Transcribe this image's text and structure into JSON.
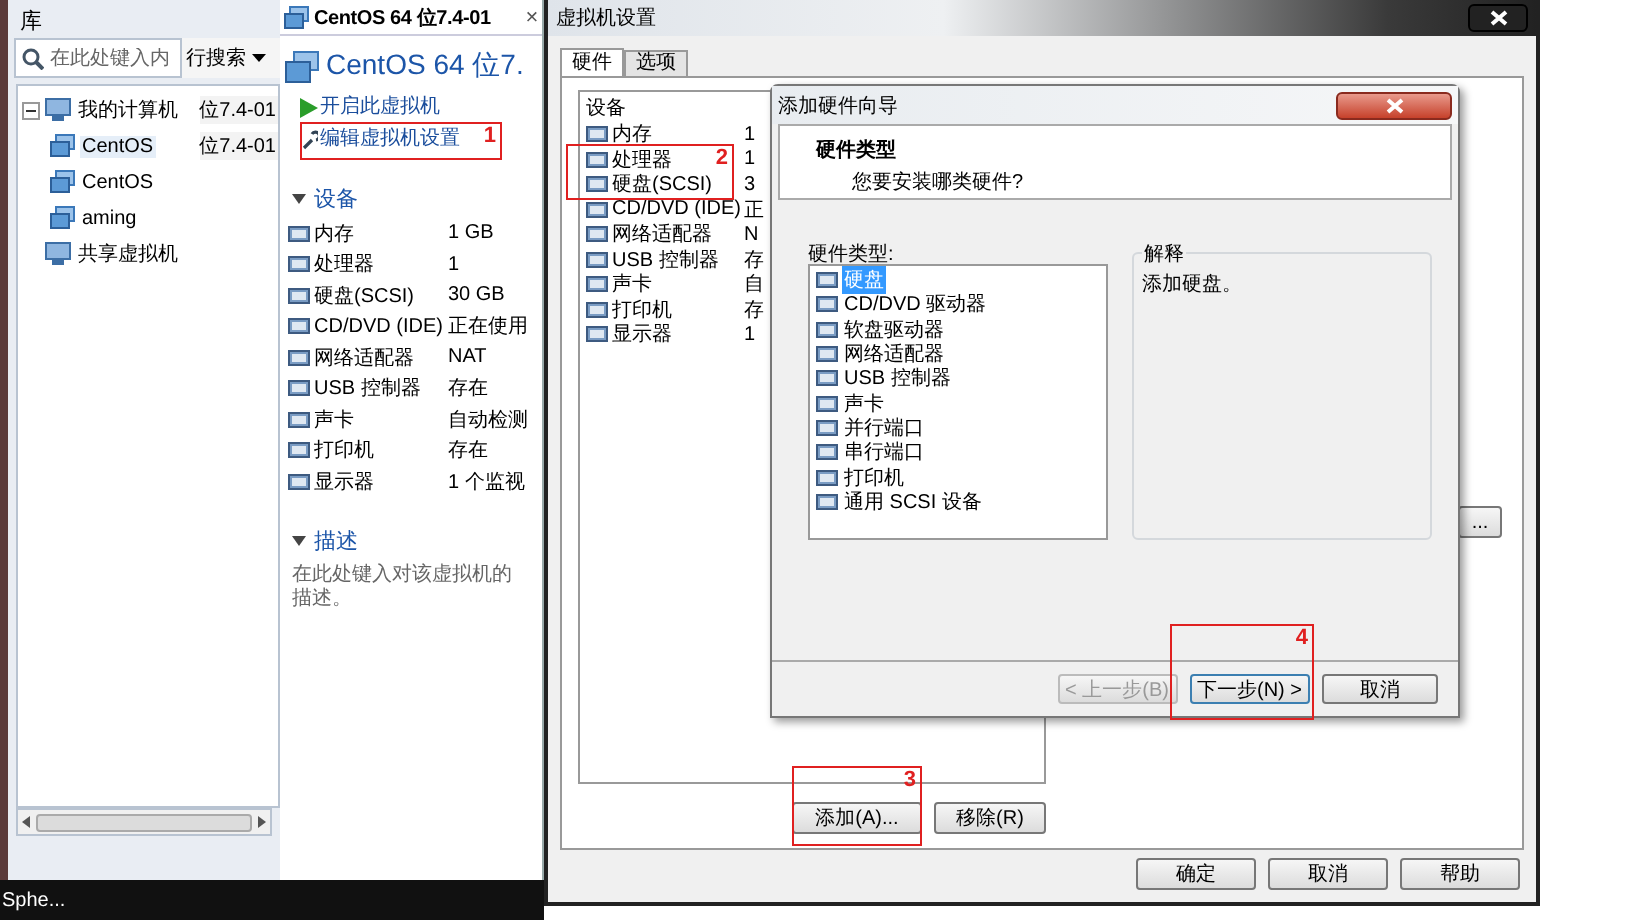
{
  "library": {
    "title": "库",
    "search": {
      "placeholder": "在此处键入内"
    },
    "search_overlap": "行搜索",
    "tree": [
      {
        "label": "我的计算机",
        "trailing": "位7.4-01",
        "expanded": true,
        "children": [
          {
            "label": "CentOS",
            "trailing": "位7.4-01",
            "selected": true
          },
          {
            "label": "CentOS",
            "selected": false
          },
          {
            "label": "aming",
            "selected": false
          }
        ]
      },
      {
        "label": "共享虚拟机"
      }
    ]
  },
  "vm_tab": {
    "tab": {
      "title": "CentOS 64 位7.4-01",
      "close": "×"
    },
    "heading": "CentOS 64 位7.",
    "actions": [
      "开启此虚拟机",
      "编辑虚拟机设置"
    ],
    "devices_section": {
      "title": "设备",
      "expanded": true
    },
    "devices": [
      {
        "name": "内存",
        "value": "1 GB"
      },
      {
        "name": "处理器",
        "value": "1"
      },
      {
        "name": "硬盘(SCSI)",
        "value": "30 GB"
      },
      {
        "name": "CD/DVD (IDE)",
        "value": "正在使用"
      },
      {
        "name": "网络适配器",
        "value": "NAT"
      },
      {
        "name": "USB 控制器",
        "value": "存在"
      },
      {
        "name": "声卡",
        "value": "自动检测"
      },
      {
        "name": "打印机",
        "value": "存在"
      },
      {
        "name": "显示器",
        "value": "1 个监视"
      }
    ],
    "description_section": {
      "title": "描述",
      "expanded": true
    },
    "description_placeholder": "在此处键入对该虚拟机的描述。"
  },
  "settings": {
    "title": "虚拟机设置",
    "tabs": [
      {
        "label": "硬件",
        "selected": true
      },
      {
        "label": "选项",
        "selected": false
      }
    ],
    "device_list": {
      "column_1": "设备",
      "rows": [
        {
          "device": "内存",
          "column_2": "1"
        },
        {
          "device": "处理器",
          "column_2": "1"
        },
        {
          "device": "硬盘(SCSI)",
          "column_2": "3"
        },
        {
          "device": "CD/DVD (IDE)",
          "column_2": "正"
        },
        {
          "device": "网络适配器",
          "column_2": "N"
        },
        {
          "device": "USB 控制器",
          "column_2": "存"
        },
        {
          "device": "声卡",
          "column_2": "自"
        },
        {
          "device": "打印机",
          "column_2": "存"
        },
        {
          "device": "显示器",
          "column_2": "1"
        }
      ]
    },
    "buttons": [
      "添加(A)...",
      "移除(R)"
    ],
    "side_button": "...",
    "footer_buttons": [
      "确定",
      "取消",
      "帮助"
    ]
  },
  "wizard": {
    "title": "添加硬件向导",
    "header": "硬件类型",
    "subtitle": "您要安装哪类硬件?",
    "list_label": "硬件类型:",
    "hardware_types": [
      {
        "label": "硬盘",
        "selected": true
      },
      {
        "label": "CD/DVD 驱动器",
        "selected": false
      },
      {
        "label": "软盘驱动器",
        "selected": false
      },
      {
        "label": "网络适配器",
        "selected": false
      },
      {
        "label": "USB 控制器",
        "selected": false
      },
      {
        "label": "声卡",
        "selected": false
      },
      {
        "label": "并行端口",
        "selected": false
      },
      {
        "label": "串行端口",
        "selected": false
      },
      {
        "label": "打印机",
        "selected": false
      },
      {
        "label": "通用 SCSI 设备",
        "selected": false
      }
    ],
    "explanation": {
      "title": "解释",
      "text": "添加硬盘。"
    },
    "buttons": [
      {
        "label": "< 上一步(B)",
        "disabled": true
      },
      {
        "label": "下一步(N) >",
        "disabled": false
      },
      {
        "label": "取消",
        "disabled": false
      }
    ]
  },
  "taskbar": {
    "item": "Sphe..."
  },
  "annotations": [
    {
      "label": "1"
    },
    {
      "label": "2"
    },
    {
      "label": "3"
    },
    {
      "label": "4"
    }
  ]
}
